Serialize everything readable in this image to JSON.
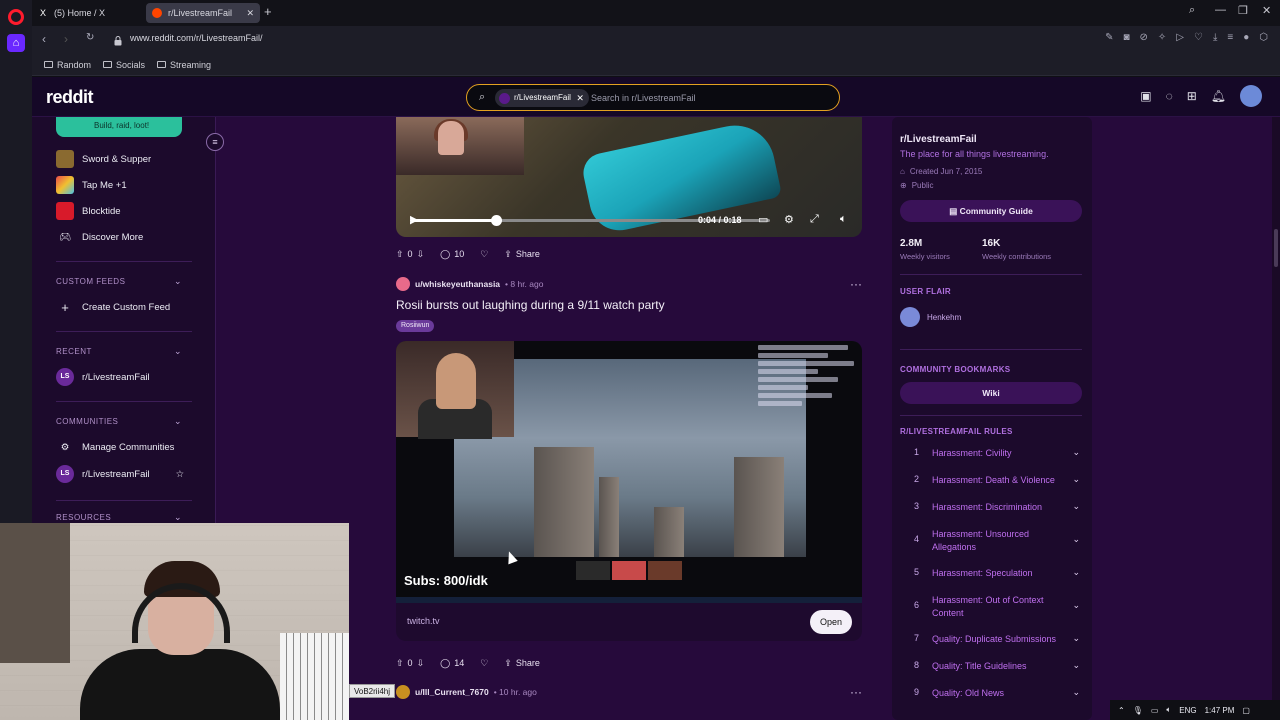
{
  "browser": {
    "tabs": [
      {
        "label": "(5) Home / X",
        "icon": "x-logo-icon"
      },
      {
        "label": "r/LivestreamFail",
        "icon": "reddit-icon"
      }
    ],
    "url": "www.reddit.com/r/LivestreamFail/",
    "bookmarks": [
      "Random",
      "Socials",
      "Streaming"
    ]
  },
  "header": {
    "logo": "reddit",
    "search_chip": "r/LivestreamFail",
    "search_placeholder": "Search in r/LivestreamFail"
  },
  "leftnav": {
    "game_card": "Build, raid, loot!",
    "games": [
      {
        "label": "Sword & Supper"
      },
      {
        "label": "Tap Me +1"
      },
      {
        "label": "Blocktide"
      }
    ],
    "discover": "Discover More",
    "custom_feeds_header": "CUSTOM FEEDS",
    "create_feed": "Create Custom Feed",
    "recent_header": "RECENT",
    "recent_item": "r/LivestreamFail",
    "communities_header": "COMMUNITIES",
    "manage": "Manage Communities",
    "community_item": "r/LivestreamFail",
    "resources_header": "RESOURCES",
    "ls_badge": "LS"
  },
  "feed": {
    "post1": {
      "video_time": "0:04 / 0:18",
      "progress": 0.24,
      "votes": "0",
      "comments": "10",
      "share": "Share"
    },
    "post2": {
      "user": "u/whiskeyeuthanasia",
      "time": "• 8 hr. ago",
      "title": "Rosii bursts out laughing during a 9/11 watch party",
      "flair": "Rosiiwun",
      "overlay_text": "Subs: 800/idk",
      "domain": "twitch.tv",
      "open": "Open",
      "votes": "0",
      "comments": "14",
      "share": "Share"
    },
    "post3": {
      "user": "u/Ill_Current_7670",
      "time": "• 10 hr. ago"
    }
  },
  "sidebar": {
    "name": "r/LivestreamFail",
    "description": "The place for all things livestreaming.",
    "created": "Created Jun 7, 2015",
    "visibility": "Public",
    "guide_button": "Community Guide",
    "visitors": "2.8M",
    "visitors_label": "Weekly visitors",
    "contributions": "16K",
    "contributions_label": "Weekly contributions",
    "user_flair_header": "USER FLAIR",
    "flair_name": "Henkehm",
    "bookmarks_header": "COMMUNITY BOOKMARKS",
    "wiki": "Wiki",
    "rules_header": "R/LIVESTREAMFAIL RULES",
    "rules": [
      {
        "num": "1",
        "text": "Harassment: Civility"
      },
      {
        "num": "2",
        "text": "Harassment: Death & Violence"
      },
      {
        "num": "3",
        "text": "Harassment: Discrimination"
      },
      {
        "num": "4",
        "text": "Harassment: Unsourced Allegations"
      },
      {
        "num": "5",
        "text": "Harassment: Speculation"
      },
      {
        "num": "6",
        "text": "Harassment: Out of Context Content"
      },
      {
        "num": "7",
        "text": "Quality: Duplicate Submissions"
      },
      {
        "num": "8",
        "text": "Quality: Title Guidelines"
      },
      {
        "num": "9",
        "text": "Quality: Old News"
      }
    ]
  },
  "overlay": {
    "tooltip": "VoB2rii4hj"
  },
  "tray": {
    "lang": "ENG",
    "time": "1:47 PM"
  },
  "colors": {
    "accent": "#b070e0",
    "page_bg": "#260a3b",
    "search_border": "#e3a120"
  }
}
